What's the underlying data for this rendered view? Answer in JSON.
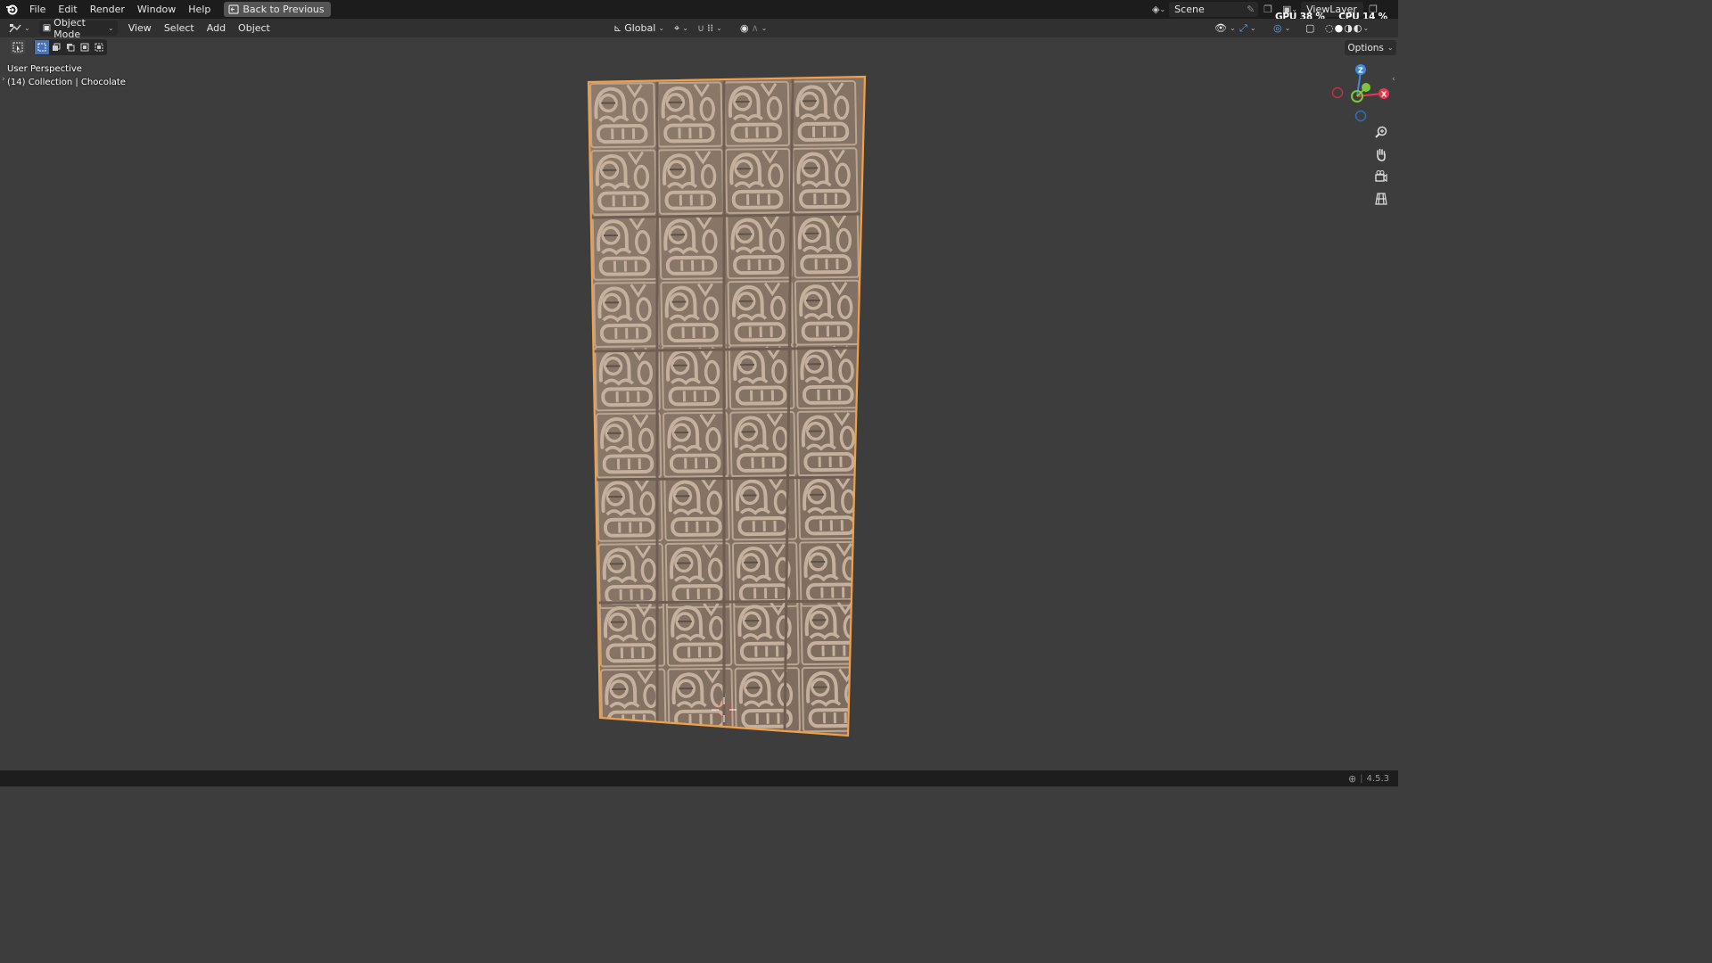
{
  "menu": {
    "file": "File",
    "edit": "Edit",
    "render": "Render",
    "window": "Window",
    "help": "Help",
    "back_to_previous": "Back to Previous"
  },
  "scene": {
    "name": "Scene"
  },
  "view_layer": {
    "name": "ViewLayer"
  },
  "stats": {
    "gpu_label": "GPU",
    "gpu_value": "38 %",
    "cpu_label": "CPU",
    "cpu_value": "14 %"
  },
  "header": {
    "mode": "Object Mode",
    "view": "View",
    "select": "Select",
    "add": "Add",
    "object": "Object",
    "orientation": "Global",
    "options": "Options"
  },
  "viewport": {
    "perspective": "User Perspective",
    "collection": "(14) Collection | Chocolate"
  },
  "gizmo": {
    "z": "Z",
    "y": "Y",
    "x": "X"
  },
  "status": {
    "version": "4.5.3"
  },
  "colors": {
    "background": "#3d3d3d",
    "topbar": "#1c1c1c",
    "header": "#303030",
    "selection_outline": "#f0a04b",
    "chocolate": "#8d7a6a",
    "axis_x": "#e8364f",
    "axis_y": "#7bc83c",
    "axis_z": "#3e8ae0"
  },
  "icons": [
    "blender-logo-icon",
    "back-icon",
    "editor-type-icon",
    "object-mode-icon",
    "transform-orientation-icon",
    "pivot-icon",
    "snap-icon",
    "proportional-icon",
    "select-box-icon",
    "visibility-icon",
    "gizmo-icon",
    "overlay-icon",
    "xray-icon",
    "shading-solid-icon",
    "zoom-icon",
    "pan-hand-icon",
    "camera-icon",
    "grid-icon"
  ]
}
